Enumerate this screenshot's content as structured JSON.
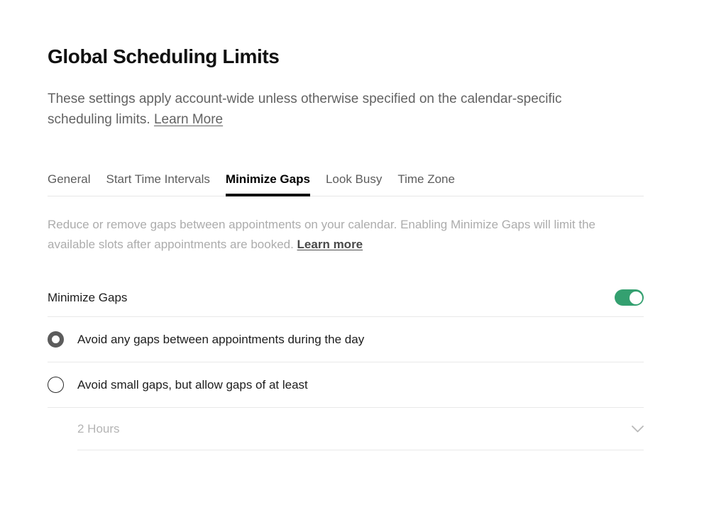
{
  "header": {
    "title": "Global Scheduling Limits",
    "description_before": "These settings apply account-wide unless otherwise specified on the calendar-specific scheduling limits. ",
    "description_link": "Learn More"
  },
  "tabs": [
    {
      "label": "General",
      "active": false
    },
    {
      "label": "Start Time Intervals",
      "active": false
    },
    {
      "label": "Minimize Gaps",
      "active": true
    },
    {
      "label": "Look Busy",
      "active": false
    },
    {
      "label": "Time Zone",
      "active": false
    }
  ],
  "section": {
    "description_before": "Reduce or remove gaps between appointments on your calendar. Enabling Minimize Gaps will limit the available slots after appointments are booked. ",
    "description_link": "Learn more"
  },
  "toggle_row": {
    "label": "Minimize Gaps",
    "state": "on",
    "color": "#34a070"
  },
  "options": [
    {
      "label": "Avoid any gaps between appointments during the day",
      "selected": true
    },
    {
      "label": "Avoid small gaps, but allow gaps of at least",
      "selected": false
    }
  ],
  "gap_select": {
    "value": "2 Hours",
    "icon": "chevron-down-icon"
  }
}
